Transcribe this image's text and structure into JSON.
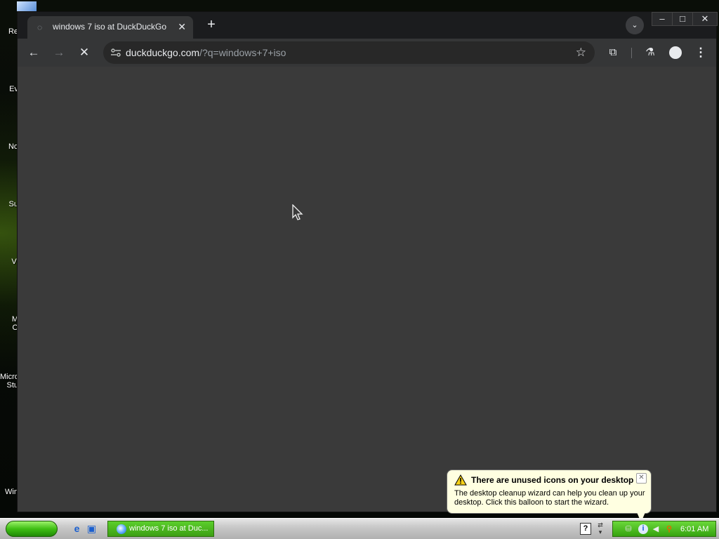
{
  "desktop": {
    "icon_labels": [
      "Re",
      "Ev",
      "No",
      "Su",
      "Vi",
      "M",
      "O",
      "Micro",
      "Stu",
      "Win"
    ]
  },
  "browser": {
    "tab": {
      "title": "windows 7 iso at DuckDuckGo",
      "close_glyph": "✕"
    },
    "new_tab_glyph": "+",
    "tab_search_glyph": "⌄",
    "window_controls": {
      "minimize": "–",
      "maximize": "□",
      "close": "✕"
    },
    "toolbar": {
      "back_glyph": "←",
      "forward_glyph": "→",
      "stop_glyph": "✕",
      "url_host": "duckduckgo.com",
      "url_rest": "/?q=windows+7+iso",
      "bookmark_glyph": "☆",
      "extensions_glyph": "⧉",
      "labs_glyph": "⚗",
      "menu_glyph": "⋮"
    }
  },
  "balloon": {
    "title": "There are unused icons on your desktop",
    "body": "The desktop cleanup wizard can help you clean up your desktop. Click this balloon to start the wizard.",
    "close_glyph": "✕"
  },
  "taskbar": {
    "task_button_label": "windows 7 iso at Duc...",
    "help_glyph": "?",
    "clock": "6:01 AM"
  }
}
